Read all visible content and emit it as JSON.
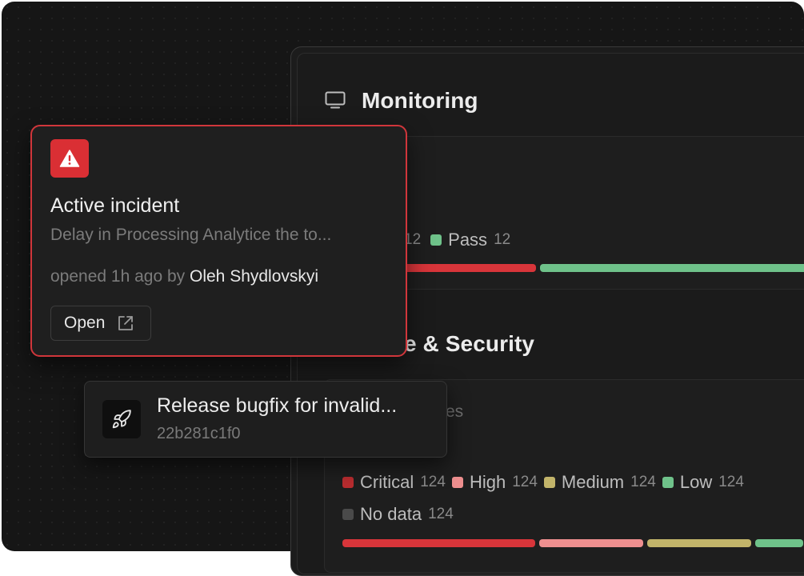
{
  "monitoring": {
    "title": "Monitoring",
    "checks_card": {
      "visible_items": [
        {
          "label": "",
          "count": "12",
          "color": "#d8353a"
        },
        {
          "label": "Pass",
          "count": "12",
          "color": "#6fc28a"
        }
      ],
      "bar": [
        {
          "status": "fail",
          "color": "#d8353a"
        },
        {
          "status": "pass",
          "color": "#6fc28a"
        }
      ]
    }
  },
  "security": {
    "title": "e & Security",
    "subtitle_fragment": "es",
    "vulnerabilities": [
      {
        "label": "Critical",
        "count": "124",
        "color": "#b82c2f"
      },
      {
        "label": "High",
        "count": "124",
        "color": "#ee8f8f"
      },
      {
        "label": "Medium",
        "count": "124",
        "color": "#c2b46a"
      },
      {
        "label": "Low",
        "count": "124",
        "color": "#6fc28a"
      },
      {
        "label": "No data",
        "count": "124",
        "color": "#4a4a4a"
      }
    ]
  },
  "incident": {
    "title": "Active incident",
    "description": "Delay in Processing Analytice the to...",
    "meta_prefix": "opened 1h ago by",
    "author": "Oleh Shydlovskyi",
    "open_label": "Open",
    "accent_color": "#da2f34"
  },
  "release": {
    "title": "Release bugfix for invalid...",
    "hash": "22b281c1f0"
  }
}
